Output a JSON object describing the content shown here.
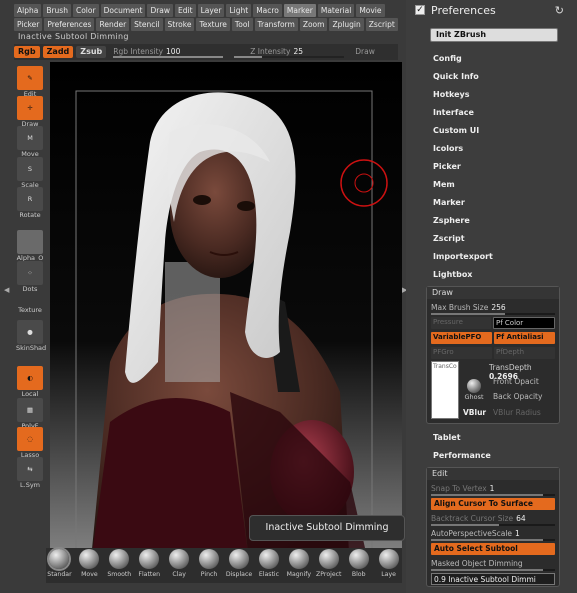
{
  "menus": {
    "row1": [
      "Alpha",
      "Brush",
      "Color",
      "Document",
      "Draw",
      "Edit",
      "Layer",
      "Light",
      "Macro",
      "Marker",
      "Material",
      "Movie"
    ],
    "row2": [
      "Picker",
      "Preferences",
      "Render",
      "Stencil",
      "Stroke",
      "Texture",
      "Tool",
      "Transform",
      "Zoom",
      "Zplugin",
      "Zscript"
    ],
    "active_row1": "Marker"
  },
  "document_title": "Inactive Subtool Dimming",
  "shelf": {
    "rgb": "Rgb",
    "zadd": "Zadd",
    "zsub": "Zsub",
    "rgb_intensity_label": "Rgb Intensity",
    "rgb_intensity_value": "100",
    "z_intensity_label": "Z Intensity",
    "z_intensity_value": "25",
    "draw_label": "Draw"
  },
  "left_tools": [
    {
      "label": "Edit",
      "glyph": "✎",
      "state": "on"
    },
    {
      "label": "Draw",
      "glyph": "✛",
      "state": "on"
    },
    {
      "label": "Move",
      "glyph": "M",
      "state": "off"
    },
    {
      "label": "Scale",
      "glyph": "S",
      "state": "off"
    },
    {
      "label": "Rotate",
      "glyph": "R",
      "state": "off"
    },
    {
      "label": "Alpha_O",
      "glyph": "",
      "state": "grey"
    },
    {
      "label": "Dots",
      "glyph": "⁘",
      "state": "off"
    },
    {
      "label": "Texture",
      "glyph": "",
      "state": "none"
    },
    {
      "label": "SkinShad",
      "glyph": "●",
      "state": "off"
    },
    {
      "label": "Local",
      "glyph": "◐",
      "state": "on"
    },
    {
      "label": "PolyF",
      "glyph": "▦",
      "state": "off"
    },
    {
      "label": "Lasso",
      "glyph": "◌",
      "state": "on"
    },
    {
      "label": "L.Sym",
      "glyph": "⇆",
      "state": "off"
    }
  ],
  "tooltip": "Inactive Subtool Dimming",
  "brushes": [
    "Standar",
    "Move",
    "Smooth",
    "Flatten",
    "Clay",
    "Pinch",
    "Displace",
    "Elastic",
    "Magnify",
    "ZProject",
    "Blob",
    "Laye"
  ],
  "selected_brush": "Standar",
  "prefs": {
    "title": "Preferences",
    "checked": true,
    "reset_icon": "↻",
    "init_button": "Init ZBrush",
    "items": [
      "Config",
      "Quick Info",
      "Hotkeys",
      "Interface",
      "Custom UI",
      "Icolors",
      "Picker",
      "Mem",
      "Marker",
      "Zsphere",
      "Zscript",
      "Importexport",
      "Lightbox"
    ],
    "draw_panel": {
      "title": "Draw",
      "max_brush_label": "Max Brush Size",
      "max_brush_value": "256",
      "pressure_label": "Pressure",
      "pf_color": "Pf Color",
      "variable_pfo": "VariablePFO",
      "pf_antialias": "Pf Antialiasi",
      "pfgro_label": "PFGro",
      "pfdepth_label": "PfDepth",
      "trans_label": "TransCo",
      "transdepth_label": "TransDepth",
      "transdepth_value": "0.2696",
      "ghost_label": "Ghost",
      "front_opacity": "Front Opacit",
      "back_opacity": "Back Opacity",
      "vblur": "VBlur",
      "vblur_radius": "VBlur Radius"
    },
    "tablet": "Tablet",
    "performance": "Performance",
    "edit_panel": {
      "title": "Edit",
      "snap_label": "Snap To Vertex",
      "snap_value": "1",
      "align_cursor": "Align Cursor To Surface",
      "backtrack_label": "Backtrack Cursor Size",
      "backtrack_value": "64",
      "autopersp_label": "AutoPerspectiveScale",
      "autopersp_value": "1",
      "auto_select": "Auto Select Subtool",
      "masked_dimming": "Masked Object Dimming",
      "inactive_dimming": "0.9 Inactive Subtool Dimmi"
    }
  },
  "colors": {
    "accent": "#e46a1e",
    "panel": "#3d3d3d",
    "canvas": "#000000",
    "ring": "#cc1111"
  }
}
